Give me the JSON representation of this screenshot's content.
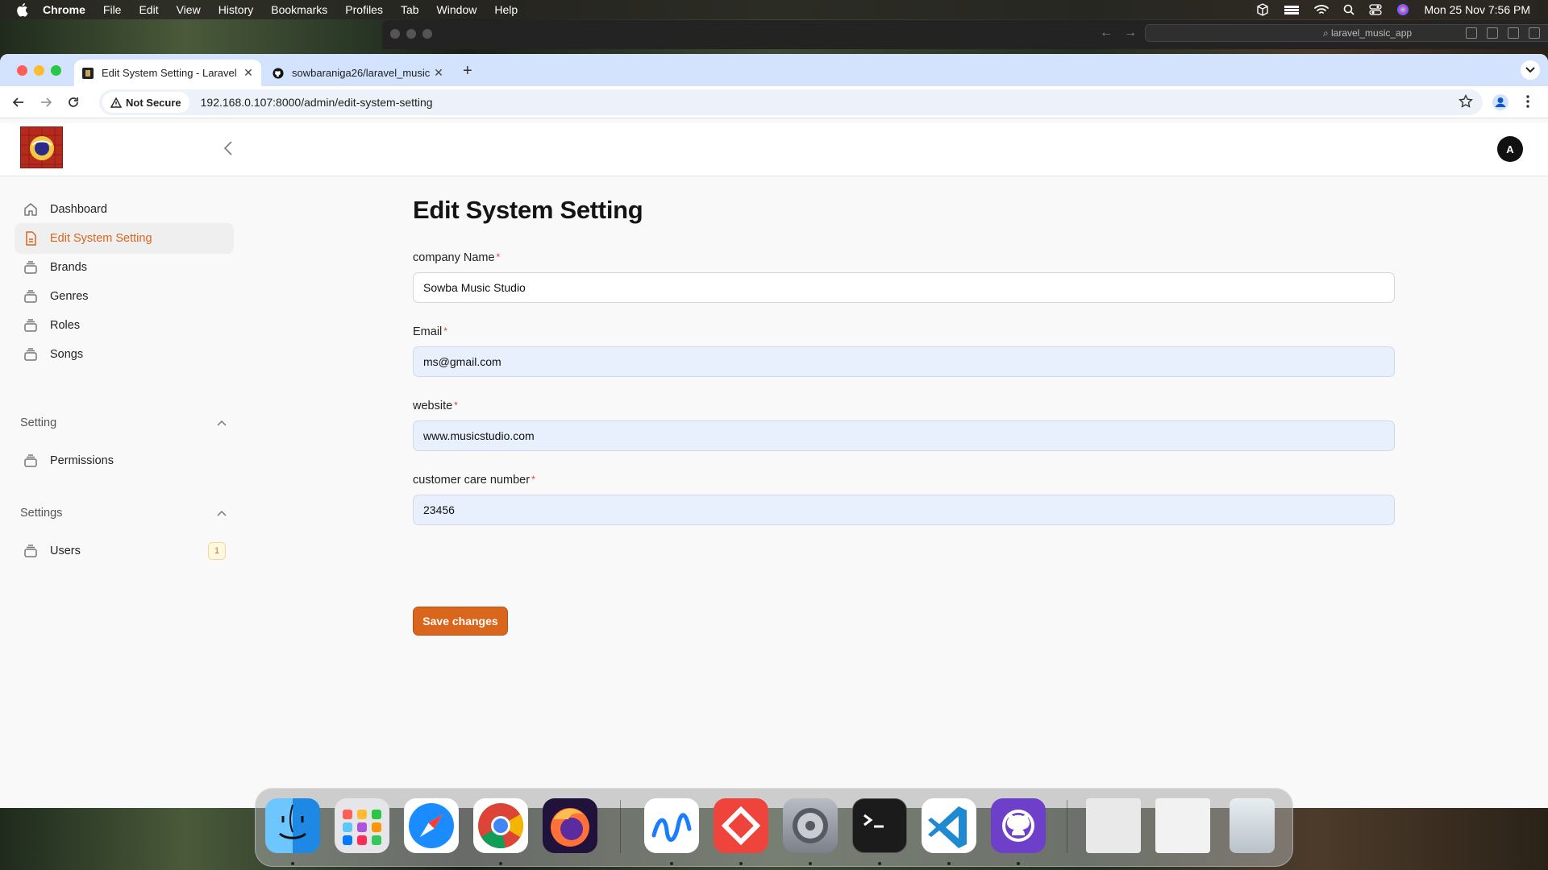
{
  "menubar": {
    "app": "Chrome",
    "items": [
      "File",
      "Edit",
      "View",
      "History",
      "Bookmarks",
      "Profiles",
      "Tab",
      "Window",
      "Help"
    ],
    "clock": "Mon 25 Nov  7:56 PM"
  },
  "background_window": {
    "address": "laravel_music_app"
  },
  "browser": {
    "tabs": [
      {
        "title": "Edit System Setting - Laravel",
        "active": true
      },
      {
        "title": "sowbaraniga26/laravel_music",
        "active": false
      }
    ],
    "security_label": "Not Secure",
    "url": "192.168.0.107:8000/admin/edit-system-setting"
  },
  "app": {
    "avatar_initial": "A",
    "nav": [
      {
        "label": "Dashboard",
        "icon": "home-icon",
        "active": false
      },
      {
        "label": "Edit System Setting",
        "icon": "document-icon",
        "active": true
      },
      {
        "label": "Brands",
        "icon": "stack-icon",
        "active": false
      },
      {
        "label": "Genres",
        "icon": "stack-icon",
        "active": false
      },
      {
        "label": "Roles",
        "icon": "stack-icon",
        "active": false
      },
      {
        "label": "Songs",
        "icon": "stack-icon",
        "active": false
      }
    ],
    "groups": [
      {
        "label": "Setting",
        "items": [
          {
            "label": "Permissions",
            "icon": "stack-icon"
          }
        ]
      },
      {
        "label": "Settings",
        "items": [
          {
            "label": "Users",
            "icon": "stack-icon",
            "badge": "1"
          }
        ]
      }
    ]
  },
  "form": {
    "title": "Edit System Setting",
    "fields": [
      {
        "label": "company Name",
        "required_mark": "*",
        "value": "Sowba Music Studio"
      },
      {
        "label": "Email",
        "required_mark": "*",
        "value": "ms@gmail.com"
      },
      {
        "label": "website",
        "required_mark": "*",
        "value": "www.musicstudio.com"
      },
      {
        "label": "customer care number",
        "required_mark": "*",
        "value": "23456"
      }
    ],
    "submit_label": "Save changes"
  },
  "colors": {
    "accent": "#d9661c",
    "tab_strip": "#d3e3fd",
    "autofill_bg": "#e8f0fe"
  },
  "dock": {
    "apps": [
      "Finder",
      "Launchpad",
      "Safari",
      "Chrome",
      "Firefox",
      "Freeform",
      "AnyDesk",
      "System Settings",
      "Terminal",
      "Visual Studio Code",
      "GitHub Desktop"
    ]
  }
}
